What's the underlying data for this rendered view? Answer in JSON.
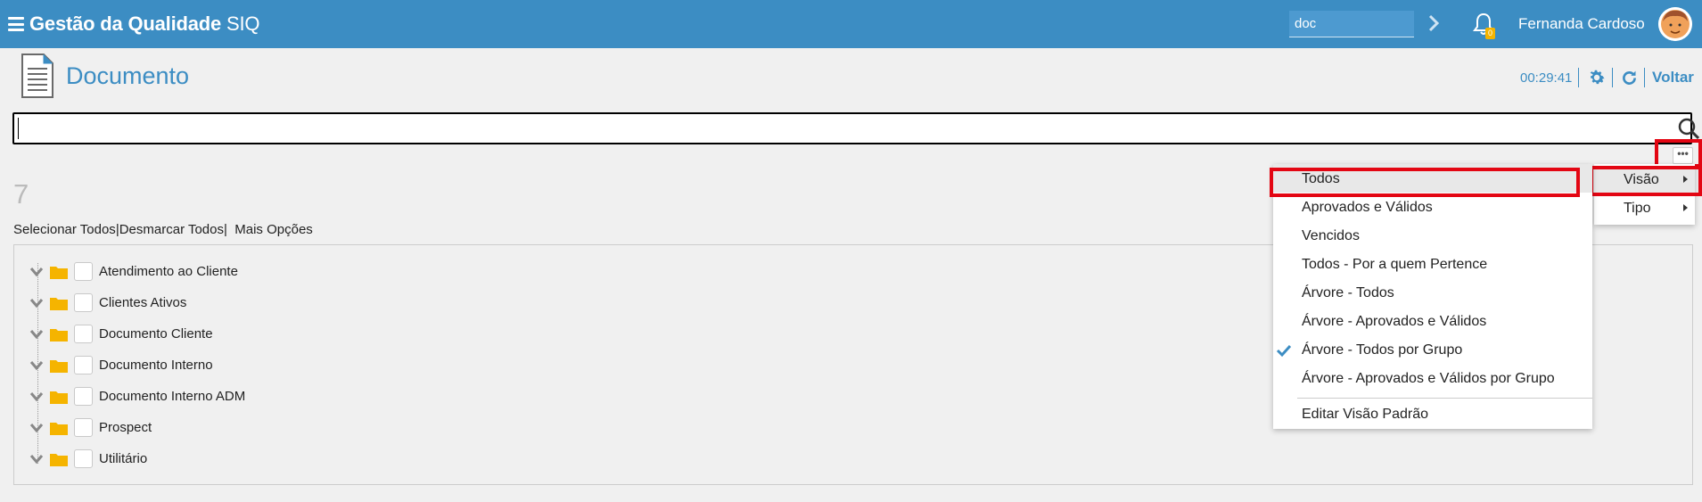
{
  "header": {
    "app_title_bold": "Gestão da Qualidade",
    "app_title_sub": "SIQ",
    "search_value": "doc",
    "notification_count": "0",
    "user_name": "Fernanda Cardoso",
    "accent_color": "#3c8dc3"
  },
  "page": {
    "title": "Documento",
    "timer": "00:29:41",
    "back_label": "Voltar"
  },
  "search": {
    "value": ""
  },
  "results": {
    "count": "7",
    "select_all": "Selecionar Todos",
    "deselect_all": "Desmarcar Todos",
    "more_options": "Mais Opções",
    "separator": "|"
  },
  "tree": {
    "items": [
      {
        "label": "Atendimento ao Cliente"
      },
      {
        "label": "Clientes Ativos"
      },
      {
        "label": "Documento Cliente"
      },
      {
        "label": "Documento Interno"
      },
      {
        "label": "Documento Interno ADM"
      },
      {
        "label": "Prospect"
      },
      {
        "label": "Utilitário"
      }
    ]
  },
  "more_button": {
    "label": "•••"
  },
  "submenu": {
    "items": [
      {
        "label": "Visão"
      },
      {
        "label": "Tipo"
      }
    ]
  },
  "view_menu": {
    "items": [
      {
        "label": "Todos"
      },
      {
        "label": "Aprovados e Válidos"
      },
      {
        "label": "Vencidos"
      },
      {
        "label": "Todos - Por a quem Pertence"
      },
      {
        "label": "Árvore - Todos"
      },
      {
        "label": "Árvore - Aprovados e Válidos"
      },
      {
        "label": "Árvore - Todos por Grupo",
        "checked": true
      },
      {
        "label": "Árvore - Aprovados e Válidos por Grupo"
      }
    ],
    "edit_default": "Editar Visão Padrão"
  }
}
